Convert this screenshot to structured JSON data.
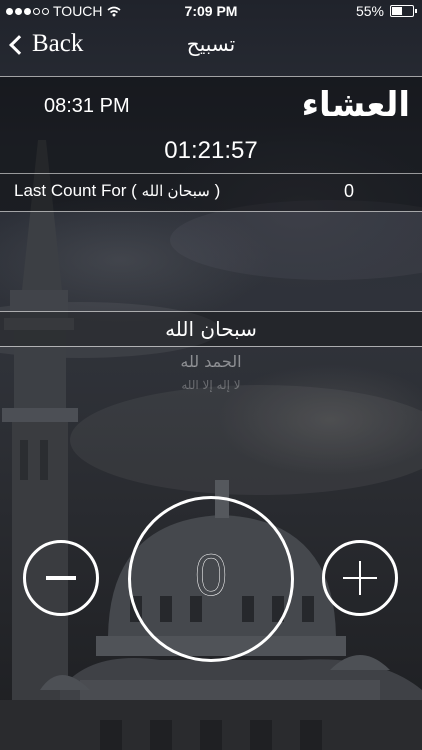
{
  "status_bar": {
    "carrier": "TOUCH",
    "time": "7:09 PM",
    "battery": "55%",
    "battery_level": 0.55
  },
  "nav": {
    "back_label": "Back",
    "title": "تسبيح"
  },
  "prayer": {
    "name": "العشاء",
    "time": "08:31 PM",
    "remaining": "01:21:57"
  },
  "last_count": {
    "label": "Last Count For (",
    "dhikr": "سبحان الله",
    "close": " )",
    "value": "0"
  },
  "picker": {
    "items": [
      "سبحان الله",
      "الحمد لله",
      "لا إله إلا الله"
    ]
  },
  "counter": {
    "value": "0"
  }
}
